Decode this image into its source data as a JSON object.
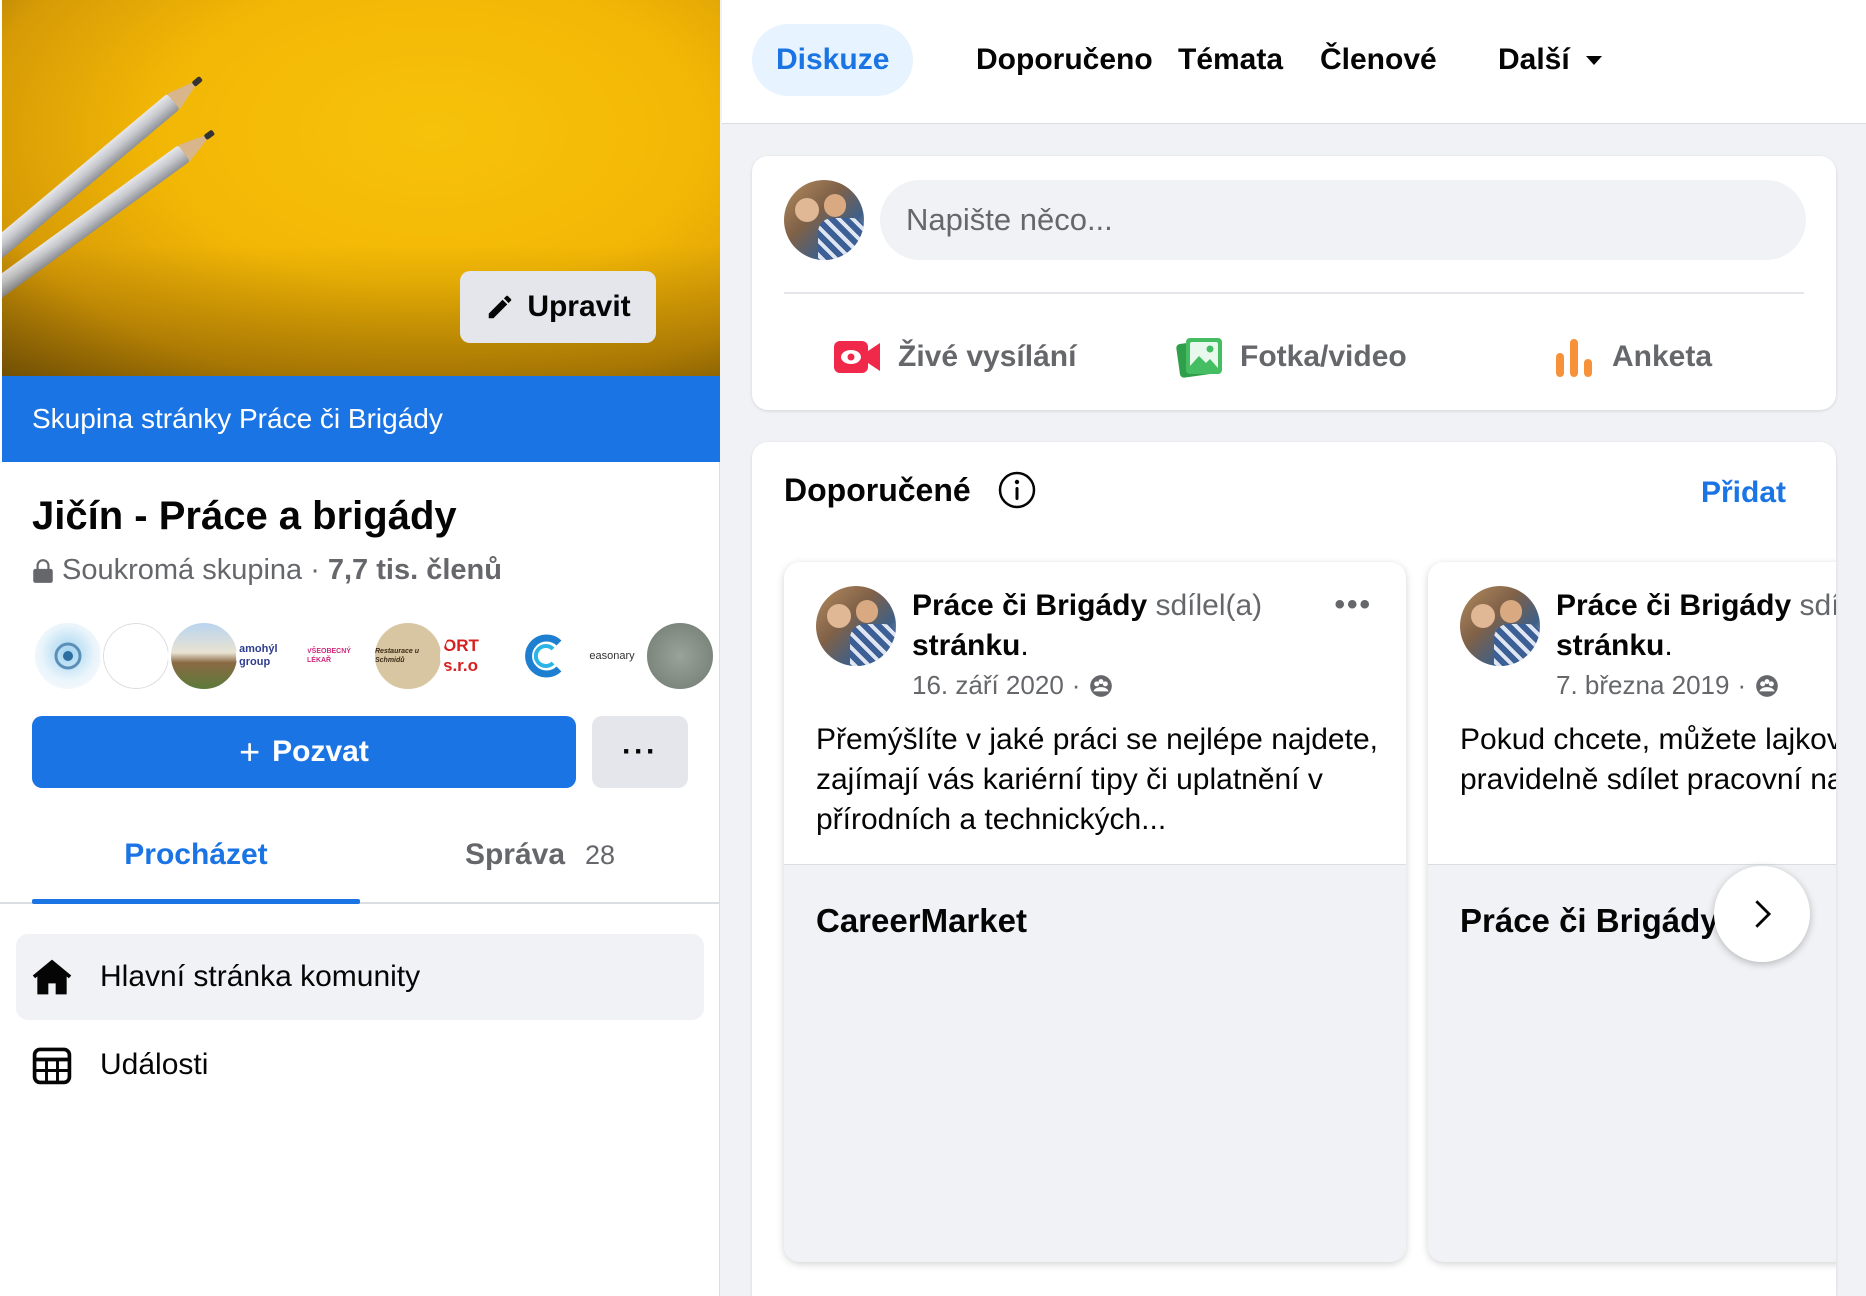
{
  "cover": {
    "edit_label": "Upravit"
  },
  "group": {
    "banner": "Skupina stránky Práce či Brigády",
    "name": "Jičín - Práce a brigády",
    "privacy": "Soukromá skupina",
    "separator": "·",
    "members": "7,7 tis. členů"
  },
  "member_avatars": [
    {
      "label": ""
    },
    {
      "label": ""
    },
    {
      "label": ""
    },
    {
      "label": "amohýl group"
    },
    {
      "label": "VŠEOBECNÝ LÉKAŘ"
    },
    {
      "label": "Restaurace u Schmidů"
    },
    {
      "label": "ORT s.r.o"
    },
    {
      "label": ""
    },
    {
      "label": "easonary"
    },
    {
      "label": ""
    }
  ],
  "actions": {
    "invite_label": "Pozvat",
    "more_label": "···"
  },
  "left_tabs": [
    {
      "label": "Procházet",
      "active": true
    },
    {
      "label": "Správa",
      "count": "28",
      "active": false
    }
  ],
  "nav": [
    {
      "label": "Hlavní stránka komunity",
      "icon": "home-icon",
      "active": true
    },
    {
      "label": "Události",
      "icon": "calendar-icon",
      "active": false
    }
  ],
  "top_tabs": [
    {
      "label": "Diskuze",
      "active": true
    },
    {
      "label": "Doporučeno",
      "active": false
    },
    {
      "label": "Témata",
      "active": false
    },
    {
      "label": "Členové",
      "active": false
    },
    {
      "label": "Další",
      "active": false,
      "dropdown": true
    }
  ],
  "composer": {
    "placeholder": "Napište něco...",
    "actions": [
      {
        "label": "Živé vysílání",
        "icon": "live-video-icon",
        "color": "#f02849"
      },
      {
        "label": "Fotka/video",
        "icon": "photo-icon",
        "color": "#45bd62"
      },
      {
        "label": "Anketa",
        "icon": "poll-icon",
        "color": "#f7923a"
      }
    ]
  },
  "recommended": {
    "title": "Doporučené",
    "add_label": "Přidat",
    "cards": [
      {
        "author": "Práce či Brigády",
        "verb": "sdílel(a)",
        "object": "stránku",
        "date": "16. září 2020",
        "dot": "·",
        "text": "Přemýšlíte v jaké práci se nejlépe najdete, zajímají vás kariérní tipy či uplatnění v přírodních a technických...",
        "page_name": "CareerMarket"
      },
      {
        "author": "Práce či Brigády",
        "verb": "sdílel(a)",
        "object": "stránku",
        "date": "7. března 2019",
        "dot": "·",
        "text": "Pokud chcete, můžete lajkovat naši stránku. Snažíme se pravidelně sdílet pracovní nabídky z různých",
        "page_name": "Práce či Brigády"
      }
    ]
  },
  "colors": {
    "accent": "#1b74e4",
    "accent_light": "#e7f3ff",
    "muted_text": "#65676b",
    "background": "#f0f2f5"
  }
}
